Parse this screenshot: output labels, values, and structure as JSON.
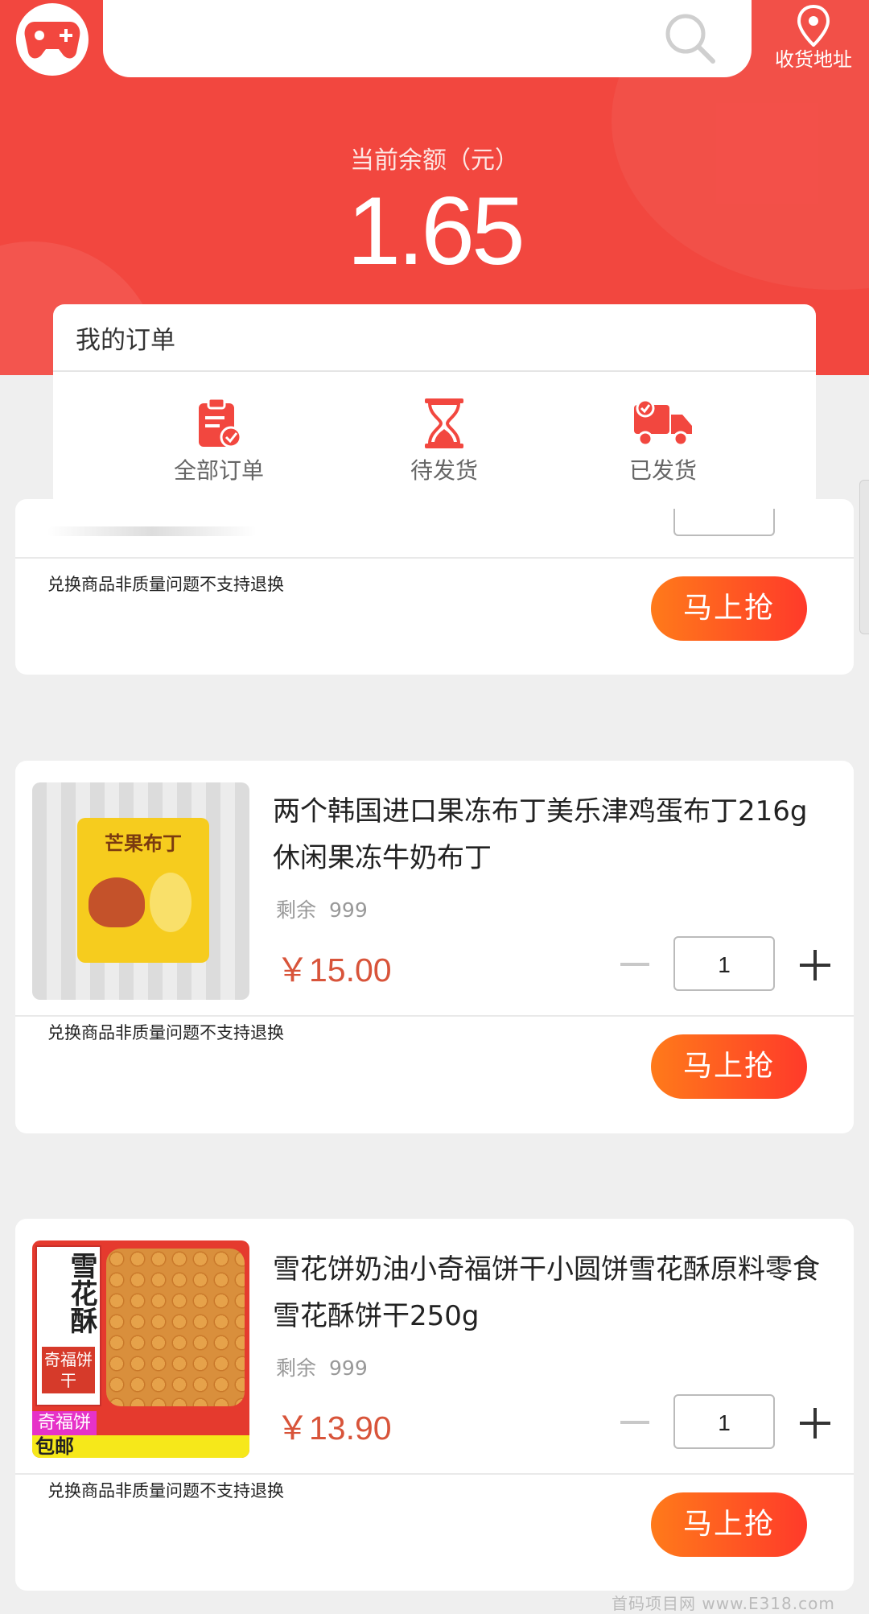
{
  "header": {
    "search_placeholder": "",
    "address_label": "收货地址",
    "balance_label": "当前余额（元）",
    "balance_value": "1.65",
    "brand_color": "#f2473f"
  },
  "orders": {
    "title": "我的订单",
    "items": [
      {
        "label": "全部订单",
        "icon": "clipboard-check-icon"
      },
      {
        "label": "待发货",
        "icon": "hourglass-icon"
      },
      {
        "label": "已发货",
        "icon": "truck-icon"
      }
    ]
  },
  "products": [
    {
      "notice": "兑换商品非质量问题不支持退换",
      "button": "马上抢"
    },
    {
      "name": "两个韩国进口果冻布丁美乐津鸡蛋布丁216g休闲果冻牛奶布丁",
      "stock_label": "剩余",
      "stock_value": "999",
      "price": "￥15.00",
      "quantity": "1",
      "notice": "兑换商品非质量问题不支持退换",
      "button": "马上抢",
      "thumb_text": "芒果布丁"
    },
    {
      "name": "雪花饼奶油小奇福饼干小圆饼雪花酥原料零食雪花酥饼干250g",
      "stock_label": "剩余",
      "stock_value": "999",
      "price": "￥13.90",
      "quantity": "1",
      "notice": "兑换商品非质量问题不支持退换",
      "button": "马上抢",
      "thumb_text": "雪花酥",
      "thumb_badge": "奇福饼干",
      "thumb_banner": "奇福饼",
      "thumb_banner2": "包邮"
    }
  ],
  "watermark": "首码项目网 www.E318.com",
  "accent_color": "#ff5a24",
  "price_color": "#d8543a"
}
